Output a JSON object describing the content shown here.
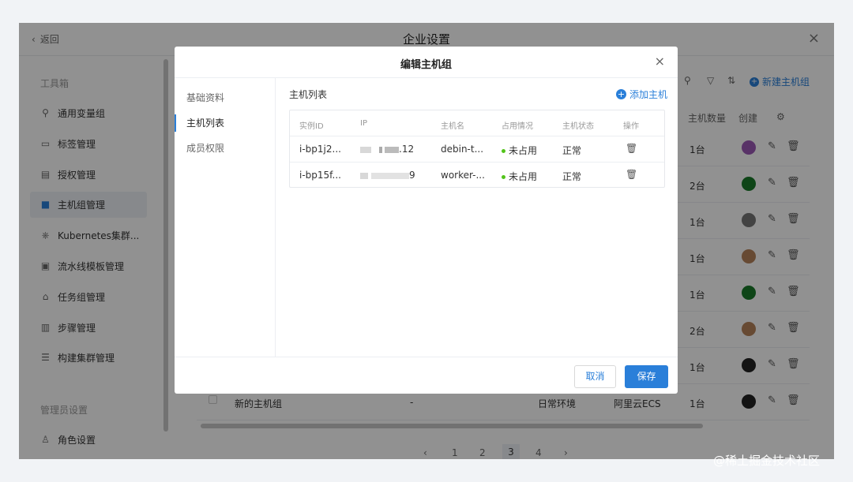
{
  "window": {
    "back_label": "返回",
    "title": "企业设置",
    "close": "×"
  },
  "sidebar": {
    "group1": "工具箱",
    "items": [
      {
        "label": "通用变量组",
        "icon": "variable-group-icon"
      },
      {
        "label": "标签管理",
        "icon": "tag-icon"
      },
      {
        "label": "授权管理",
        "icon": "authorization-icon"
      },
      {
        "label": "主机组管理",
        "icon": "host-group-icon",
        "active": true
      },
      {
        "label": "Kubernetes集群...",
        "icon": "kubernetes-icon"
      },
      {
        "label": "流水线模板管理",
        "icon": "pipeline-template-icon"
      },
      {
        "label": "任务组管理",
        "icon": "task-group-icon"
      },
      {
        "label": "步骤管理",
        "icon": "step-icon"
      },
      {
        "label": "构建集群管理",
        "icon": "build-cluster-icon"
      }
    ],
    "group2": "管理员设置",
    "items2": [
      {
        "label": "角色设置",
        "icon": "role-icon"
      }
    ]
  },
  "background": {
    "new_group_label": "新建主机组",
    "columns": {
      "host_count": "主机数量",
      "creator": "创建"
    },
    "rows": [
      {
        "count": "1台"
      },
      {
        "count": "2台"
      },
      {
        "count": "1台"
      },
      {
        "count": "1台"
      },
      {
        "count": "1台"
      },
      {
        "count": "2台"
      },
      {
        "count": "1台"
      },
      {
        "name": "新的主机组",
        "dash": "-",
        "env": "日常环境",
        "provider": "阿里云ECS",
        "count": "1台"
      }
    ],
    "pagination": {
      "prev": "‹",
      "pages": [
        "1",
        "2",
        "3",
        "4"
      ],
      "current": "3",
      "next": "›"
    }
  },
  "modal": {
    "title": "编辑主机组",
    "close": "×",
    "nav": [
      "基础资料",
      "主机列表",
      "成员权限"
    ],
    "active_nav": "主机列表",
    "section_title": "主机列表",
    "add_host_label": "添加主机",
    "table": {
      "headers": [
        "实例ID",
        "IP",
        "主机名",
        "占用情况",
        "主机状态",
        "操作"
      ],
      "rows": [
        {
          "id": "i-bp1j2...",
          "ip": ".12",
          "hostname": "debin-t...",
          "usage": "未占用",
          "status": "正常"
        },
        {
          "id": "i-bp15f...",
          "ip": "9",
          "hostname": "worker-...",
          "usage": "未占用",
          "status": "正常"
        }
      ]
    },
    "cancel_label": "取消",
    "save_label": "保存"
  },
  "watermark": "@稀土掘金技术社区",
  "colors": {
    "accent": "#2a7fd9",
    "success": "#52c41a"
  }
}
